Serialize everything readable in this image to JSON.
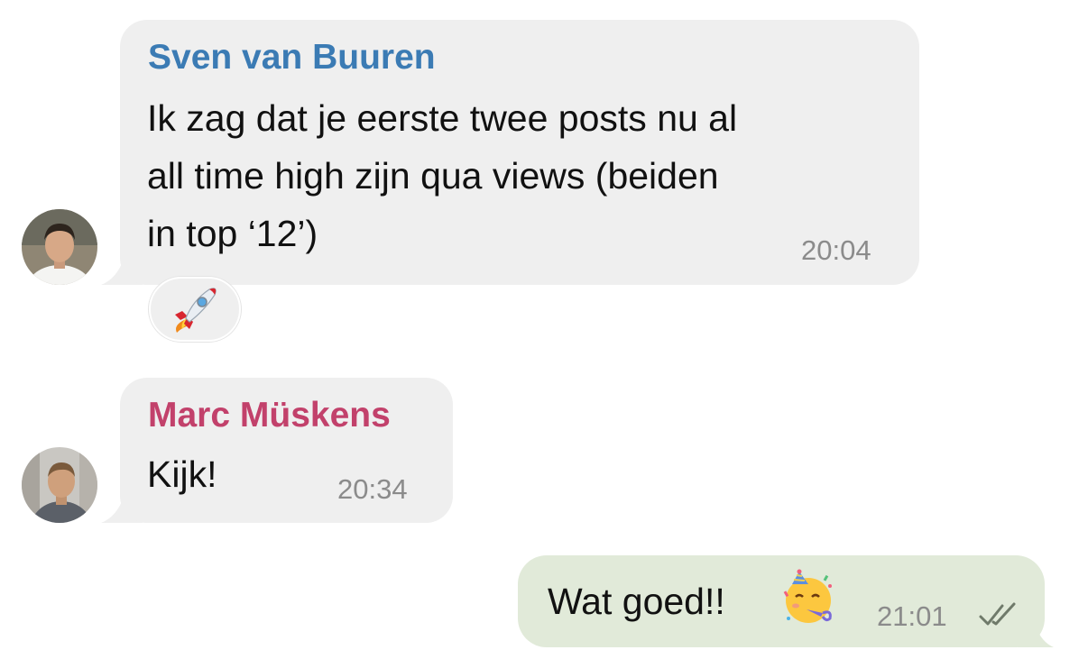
{
  "messages": [
    {
      "sender": "Sven van Buuren",
      "sender_color": "#3b7bb4",
      "lines": [
        "Ik zag dat je eerste twee posts nu al",
        "all time high zijn qua views (beiden",
        "in top ‘12’)"
      ],
      "time": "20:04",
      "reaction": "rocket-emoji"
    },
    {
      "sender": "Marc Müskens",
      "sender_color": "#c2416b",
      "lines": [
        "Kijk!"
      ],
      "time": "20:34"
    },
    {
      "outgoing": true,
      "text": "Wat goed!!",
      "emoji": "partying-face-emoji",
      "time": "21:01",
      "status": "double-check-icon"
    }
  ],
  "colors": {
    "incoming_bubble": "#efefef",
    "outgoing_bubble": "#e1ead9",
    "timestamp": "#8b8b8b"
  }
}
